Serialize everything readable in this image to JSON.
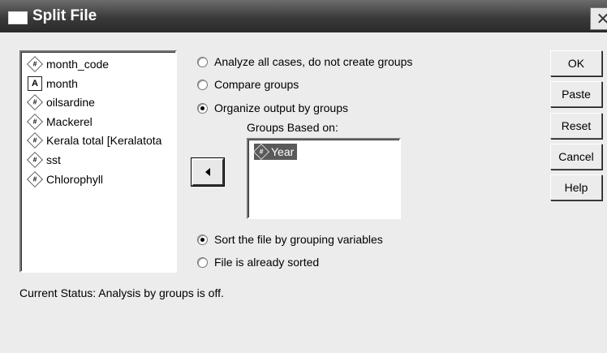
{
  "window": {
    "title": "Split File"
  },
  "variables": [
    {
      "name": "month_code",
      "type": "numeric"
    },
    {
      "name": "month",
      "type": "string"
    },
    {
      "name": "oilsardine",
      "type": "numeric"
    },
    {
      "name": "Mackerel",
      "type": "numeric"
    },
    {
      "name": "Kerala total [Keralatota",
      "type": "numeric"
    },
    {
      "name": "sst",
      "type": "numeric"
    },
    {
      "name": "Chlorophyll",
      "type": "numeric"
    }
  ],
  "group_options": [
    {
      "label": "Analyze all cases, do not create groups",
      "selected": false
    },
    {
      "label": "Compare groups",
      "selected": false
    },
    {
      "label": "Organize output by groups",
      "selected": true
    }
  ],
  "groups_based_on": {
    "label": "Groups Based on:",
    "items": [
      {
        "name": "Year",
        "type": "numeric"
      }
    ]
  },
  "sort_options": [
    {
      "label": "Sort the file by grouping variables",
      "selected": true
    },
    {
      "label": "File is already sorted",
      "selected": false
    }
  ],
  "buttons": {
    "ok": "OK",
    "paste": "Paste",
    "reset": "Reset",
    "cancel": "Cancel",
    "help": "Help"
  },
  "status": "Current Status:  Analysis by groups is off."
}
